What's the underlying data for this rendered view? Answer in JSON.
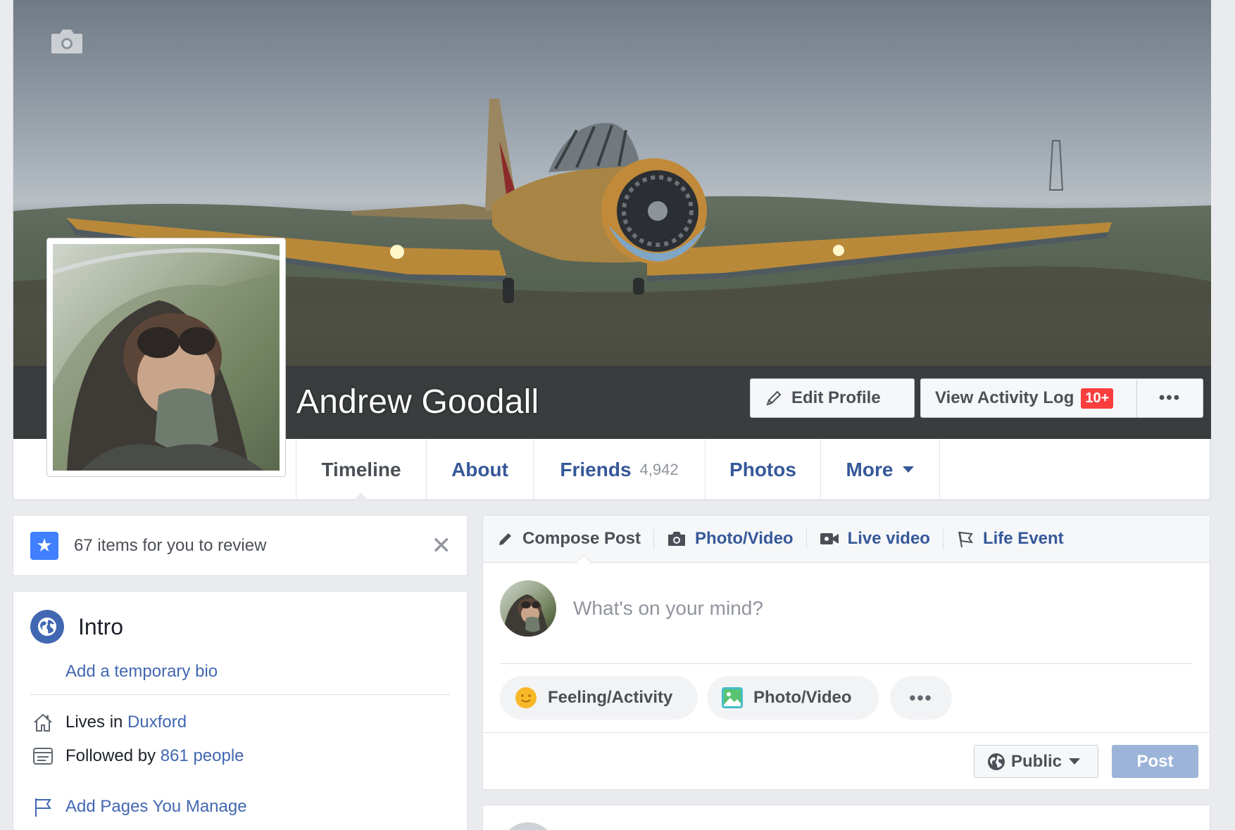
{
  "profile": {
    "name": "Andrew Goodall",
    "edit_profile_label": "Edit Profile",
    "view_activity_label": "View Activity Log",
    "activity_badge": "10+",
    "more_label": "•••"
  },
  "tabs": [
    {
      "label": "Timeline",
      "active": true
    },
    {
      "label": "About"
    },
    {
      "label": "Friends",
      "count": "4,942"
    },
    {
      "label": "Photos"
    },
    {
      "label": "More"
    }
  ],
  "review": {
    "text": "67 items for you to review",
    "close": "✕"
  },
  "intro": {
    "title": "Intro",
    "add_bio": "Add a temporary bio",
    "lives_prefix": "Lives in",
    "lives_place": "Duxford",
    "followed_prefix": "Followed by",
    "followed_count": "861 people",
    "add_pages": "Add Pages You Manage"
  },
  "composer": {
    "compose_post": "Compose Post",
    "photo_video": "Photo/Video",
    "live_video": "Live video",
    "life_event": "Life Event",
    "placeholder": "What's on your mind?",
    "feeling_activity": "Feeling/Activity",
    "photo_video_pill": "Photo/Video",
    "more_pill": "•••",
    "audience": "Public",
    "post": "Post"
  },
  "colors": {
    "link": "#365899",
    "accent": "#4267b2",
    "badge": "#fa3e3e",
    "post_disabled": "#9cb4d8"
  }
}
